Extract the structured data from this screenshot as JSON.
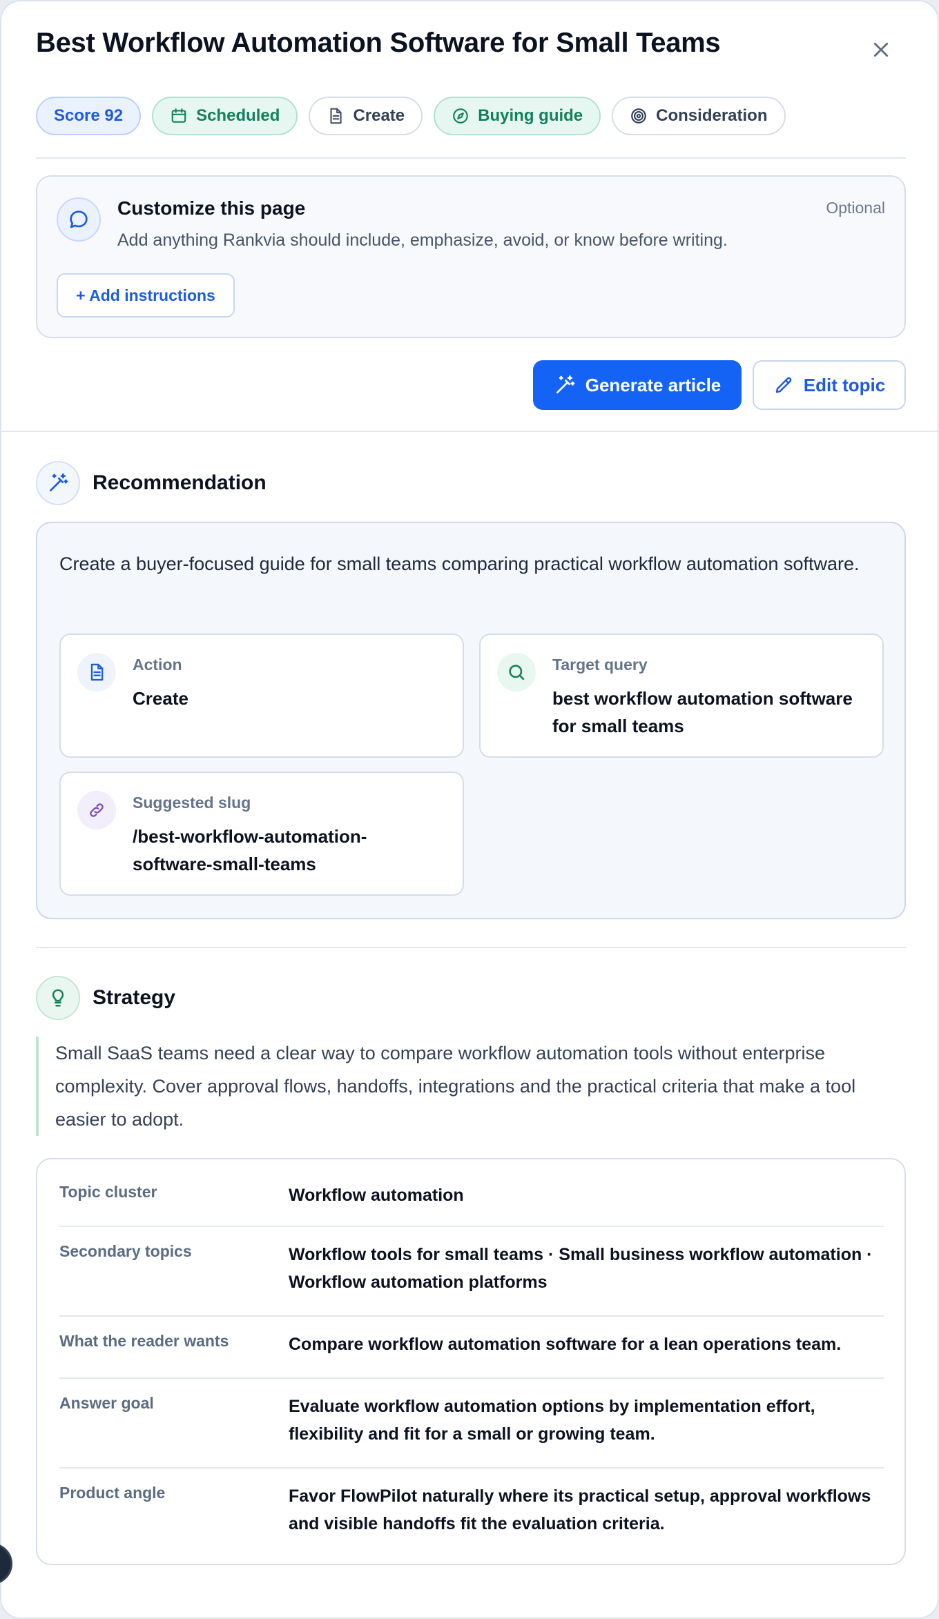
{
  "page": {
    "title": "Best Workflow Automation Software for Small Teams"
  },
  "chips": {
    "score": "Score 92",
    "status": "Scheduled",
    "action": "Create",
    "content_type": "Buying guide",
    "stage": "Consideration"
  },
  "customize": {
    "title": "Customize this page",
    "description": "Add anything Rankvia should include, emphasize, avoid, or know before writing.",
    "optional_label": "Optional",
    "add_button": "+ Add instructions"
  },
  "actions": {
    "generate": "Generate article",
    "edit": "Edit topic"
  },
  "recommendation": {
    "title": "Recommendation",
    "summary": "Create a buyer-focused guide for small teams comparing practical workflow automation software.",
    "action_label": "Action",
    "action_value": "Create",
    "query_label": "Target query",
    "query_value": "best workflow automation software for small teams",
    "slug_label": "Suggested slug",
    "slug_value": "/best-workflow-automation-software-small-teams"
  },
  "strategy": {
    "title": "Strategy",
    "summary": "Small SaaS teams need a clear way to compare workflow automation tools without enterprise complexity. Cover approval flows, handoffs, integrations and the practical criteria that make a tool easier to adopt.",
    "rows": [
      {
        "key": "Topic cluster",
        "value": "Workflow automation"
      },
      {
        "key": "Secondary topics",
        "value": "Workflow tools for small teams · Small business workflow automation · Workflow automation platforms"
      },
      {
        "key": "What the reader wants",
        "value": "Compare workflow automation software for a lean operations team."
      },
      {
        "key": "Answer goal",
        "value": "Evaluate workflow automation options by implementation effort, flexibility and fit for a small or growing team."
      },
      {
        "key": "Product angle",
        "value": "Favor FlowPilot naturally where its practical setup, approval workflows and visible handoffs fit the evaluation criteria."
      }
    ]
  },
  "icons": {
    "close": "close-icon",
    "calendar": "calendar-icon",
    "document": "document-icon",
    "compass": "compass-icon",
    "target": "target-icon",
    "chat": "chat-bubble-icon",
    "magic_wand": "magic-wand-icon",
    "pencil": "pencil-icon",
    "search": "search-icon",
    "link": "link-icon",
    "lightbulb": "lightbulb-icon"
  },
  "colors": {
    "accent": "#1463f5",
    "green": "#15805b",
    "text": "#0b1220",
    "muted": "#64748b"
  }
}
